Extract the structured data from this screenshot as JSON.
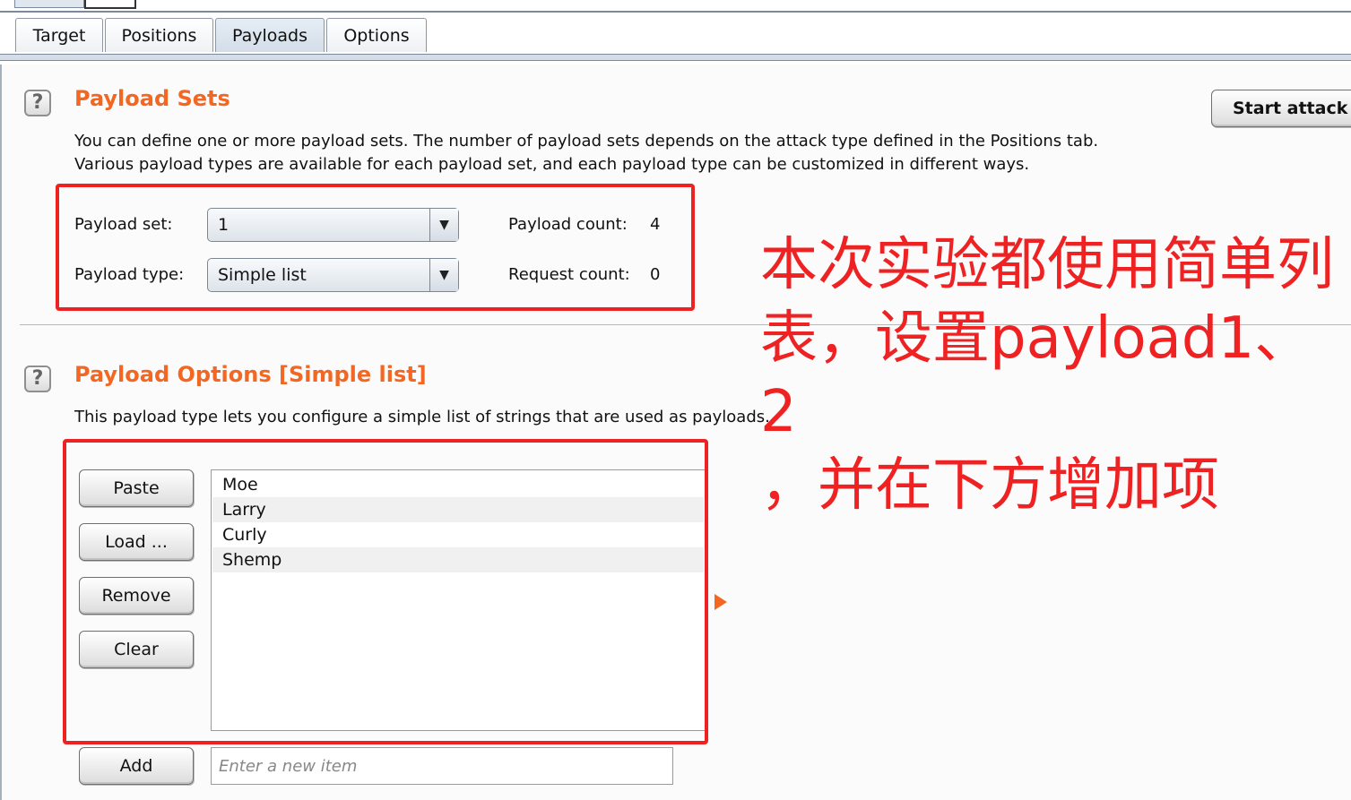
{
  "tabs": [
    "Target",
    "Positions",
    "Payloads",
    "Options"
  ],
  "active_tab": "Payloads",
  "start_attack_label": "Start attack",
  "payload_sets": {
    "heading": "Payload Sets",
    "desc_line1": "You can define one or more payload sets. The number of payload sets depends on the attack type defined in the Positions tab.",
    "desc_line2": "Various payload types are available for each payload set, and each payload type can be customized in different ways.",
    "set_label": "Payload set:",
    "set_value": "1",
    "type_label": "Payload type:",
    "type_value": "Simple list",
    "payload_count_label": "Payload count:",
    "payload_count": "4",
    "request_count_label": "Request count:",
    "request_count": "0"
  },
  "payload_options": {
    "heading": "Payload Options [Simple list]",
    "desc": "This payload type lets you configure a simple list of strings that are used as payloads.",
    "buttons": {
      "paste": "Paste",
      "load": "Load ...",
      "remove": "Remove",
      "clear": "Clear",
      "add": "Add"
    },
    "items": [
      "Moe",
      "Larry",
      "Curly",
      "Shemp"
    ],
    "new_item_placeholder": "Enter a new item"
  },
  "annotation": {
    "line1": "本次实验都使用简单列",
    "line2": "表，设置payload1、2",
    "line3": "，并在下方增加项"
  },
  "colors": {
    "heading": "#f26822",
    "annotation": "#ee2222"
  }
}
